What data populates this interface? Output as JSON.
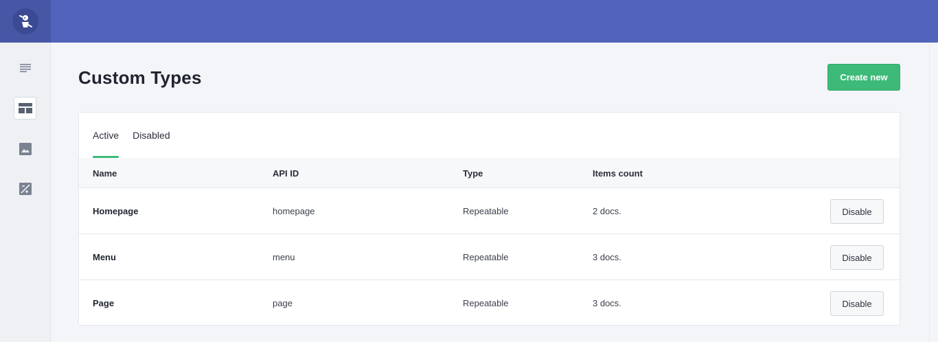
{
  "topbar": {
    "logo_icon": "prismic-logo-icon",
    "color": "#5163ba"
  },
  "sidebar": {
    "items": [
      {
        "icon": "documents-list-icon",
        "active": false
      },
      {
        "icon": "custom-types-icon",
        "active": true
      },
      {
        "icon": "media-library-icon",
        "active": false
      },
      {
        "icon": "settings-image-icon",
        "active": false
      }
    ]
  },
  "main": {
    "title": "Custom Types",
    "create_label": "Create new"
  },
  "tabs": [
    {
      "label": "Active",
      "active": true
    },
    {
      "label": "Disabled",
      "active": false
    }
  ],
  "table": {
    "columns": [
      "Name",
      "API ID",
      "Type",
      "Items count"
    ],
    "rows": [
      {
        "name": "Homepage",
        "api_id": "homepage",
        "type": "Repeatable",
        "count": "2 docs.",
        "action": "Disable"
      },
      {
        "name": "Menu",
        "api_id": "menu",
        "type": "Repeatable",
        "count": "3 docs.",
        "action": "Disable"
      },
      {
        "name": "Page",
        "api_id": "page",
        "type": "Repeatable",
        "count": "3 docs.",
        "action": "Disable"
      }
    ]
  },
  "colors": {
    "accent": "#3dba78",
    "header": "#5163ba"
  }
}
